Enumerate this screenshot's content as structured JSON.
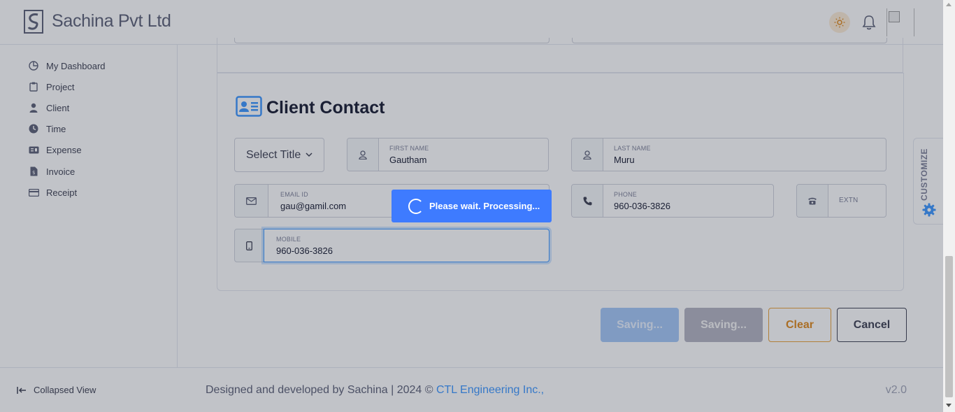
{
  "header": {
    "brand": "Sachina Pvt Ltd"
  },
  "sidebar": {
    "items": [
      {
        "label": "My Dashboard",
        "icon": "pie-chart-icon"
      },
      {
        "label": "Project",
        "icon": "clipboard-icon"
      },
      {
        "label": "Client",
        "icon": "user-icon"
      },
      {
        "label": "Time",
        "icon": "clock-icon"
      },
      {
        "label": "Expense",
        "icon": "money-bill-icon"
      },
      {
        "label": "Invoice",
        "icon": "file-invoice-icon"
      },
      {
        "label": "Receipt",
        "icon": "credit-card-icon"
      }
    ],
    "collapse_label": "Collapsed View"
  },
  "section": {
    "title": "Client Contact"
  },
  "form": {
    "title_select": "Select Title",
    "first_name": {
      "label": "FIRST NAME",
      "value": "Gautham"
    },
    "last_name": {
      "label": "LAST NAME",
      "value": "Muru"
    },
    "email": {
      "label": "EMAIL ID",
      "value": "gau@gamil.com"
    },
    "phone": {
      "label": "PHONE",
      "value": "960-036-3826"
    },
    "extn": {
      "label": "EXTN",
      "value": ""
    },
    "mobile": {
      "label": "MOBILE",
      "value": "960-036-3826"
    }
  },
  "buttons": {
    "saving1": "Saving...",
    "saving2": "Saving...",
    "clear": "Clear",
    "cancel": "Cancel"
  },
  "customize": {
    "label": "CUSTOMIZE"
  },
  "footer": {
    "credit": "Designed and developed by Sachina | 2024 © ",
    "link": "CTL Engineering Inc.,",
    "version": "v2.0"
  },
  "loader": {
    "text": "Please wait. Processing..."
  },
  "colors": {
    "primary": "#3e7bff",
    "warning": "#e08a1e",
    "overlay": "rgba(33,38,56,0.28)"
  }
}
